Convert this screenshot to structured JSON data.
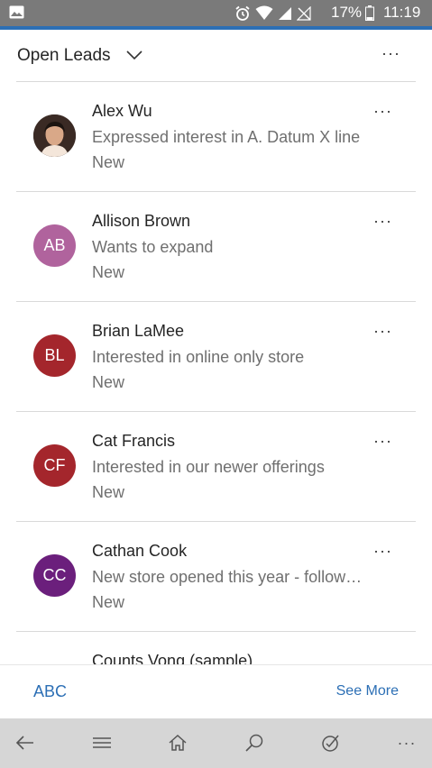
{
  "status_bar": {
    "battery_percent": "17%",
    "time": "11:19"
  },
  "header": {
    "view_name": "Open Leads",
    "more_label": "···"
  },
  "leads": [
    {
      "name": "Alex Wu",
      "topic": "Expressed interest in A. Datum X line",
      "status": "New",
      "initials": "",
      "avatar_color": "#3a2a24",
      "has_photo": true
    },
    {
      "name": "Allison Brown",
      "topic": "Wants to expand",
      "status": "New",
      "initials": "AB",
      "avatar_color": "#b0639d"
    },
    {
      "name": "Brian LaMee",
      "topic": "Interested in online only store",
      "status": "New",
      "initials": "BL",
      "avatar_color": "#a4262c"
    },
    {
      "name": "Cat Francis",
      "topic": "Interested in our newer offerings",
      "status": "New",
      "initials": "CF",
      "avatar_color": "#a4262c"
    },
    {
      "name": "Cathan Cook",
      "topic": "New store opened this year - follow up",
      "status": "New",
      "initials": "CC",
      "avatar_color": "#6b1f7c"
    },
    {
      "name": "Counts Vong (sample)",
      "topic": "",
      "status": "",
      "initials": "",
      "avatar_color": "#ffffff"
    }
  ],
  "row_more_label": "···",
  "footer": {
    "abc_label": "ABC",
    "see_more_label": "See More"
  },
  "app_bar": {
    "more_label": "···",
    "icons": [
      "back-icon",
      "menu-icon",
      "home-icon",
      "search-icon",
      "assistant-icon",
      "more-icon"
    ]
  },
  "colors": {
    "accent": "#2c6fb5",
    "status_bar": "#7a7a7a",
    "app_bar": "#d6d6d6"
  }
}
